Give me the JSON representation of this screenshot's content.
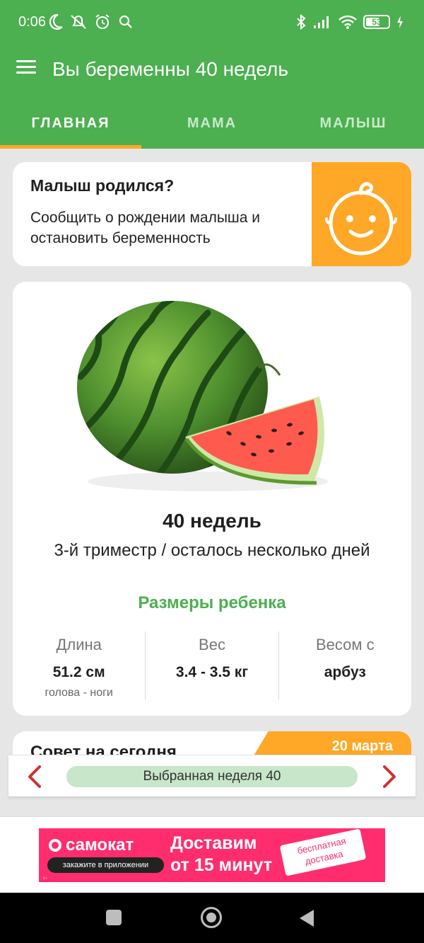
{
  "status_bar": {
    "time": "0:06",
    "left_icons": [
      "moon-icon",
      "notifications-off-icon",
      "alarm-icon",
      "search-icon"
    ],
    "right_icons": [
      "bluetooth-icon",
      "signal-icon",
      "wifi-icon",
      "battery-icon",
      "charging-icon"
    ],
    "battery_level": "53"
  },
  "app_bar": {
    "title": "Вы беременны 40 недель",
    "menu_icon": "menu-icon"
  },
  "tabs": [
    {
      "label": "ГЛАВНАЯ",
      "active": true
    },
    {
      "label": "МАМА",
      "active": false
    },
    {
      "label": "МАЛЫШ",
      "active": false
    }
  ],
  "born_card": {
    "heading": "Малыш родился?",
    "description": "Сообщить о рождении малыша и остановить беременность",
    "icon": "baby-face-icon"
  },
  "week_card": {
    "fruit_image": "watermelon",
    "weeks": "40 недель",
    "trimester": "3-й триместр / осталось несколько дней",
    "sizes_title": "Размеры ребенка",
    "stats": [
      {
        "label": "Длина",
        "value": "51.2 см",
        "sub": "голова - ноги"
      },
      {
        "label": "Вес",
        "value": "3.4 - 3.5 кг",
        "sub": ""
      },
      {
        "label": "Весом с",
        "value": "арбуз",
        "sub": ""
      }
    ]
  },
  "tip_card": {
    "title": "Совет на сегодня",
    "date": "20 марта"
  },
  "week_selector": {
    "label": "Выбранная неделя 40"
  },
  "ad_banner": {
    "brand": "самокат",
    "app_button": "закажите в приложении",
    "slogan_line1": "Доставим",
    "slogan_line2": "от 15 минут",
    "sticker_line1": "бесплатная",
    "sticker_line2": "доставка",
    "age_rating": "6+"
  },
  "colors": {
    "primary": "#4caf50",
    "accent": "#ffa726",
    "pill": "#c8e6c9",
    "arrow": "#d32f2f",
    "ad": "#ff2d6e"
  }
}
